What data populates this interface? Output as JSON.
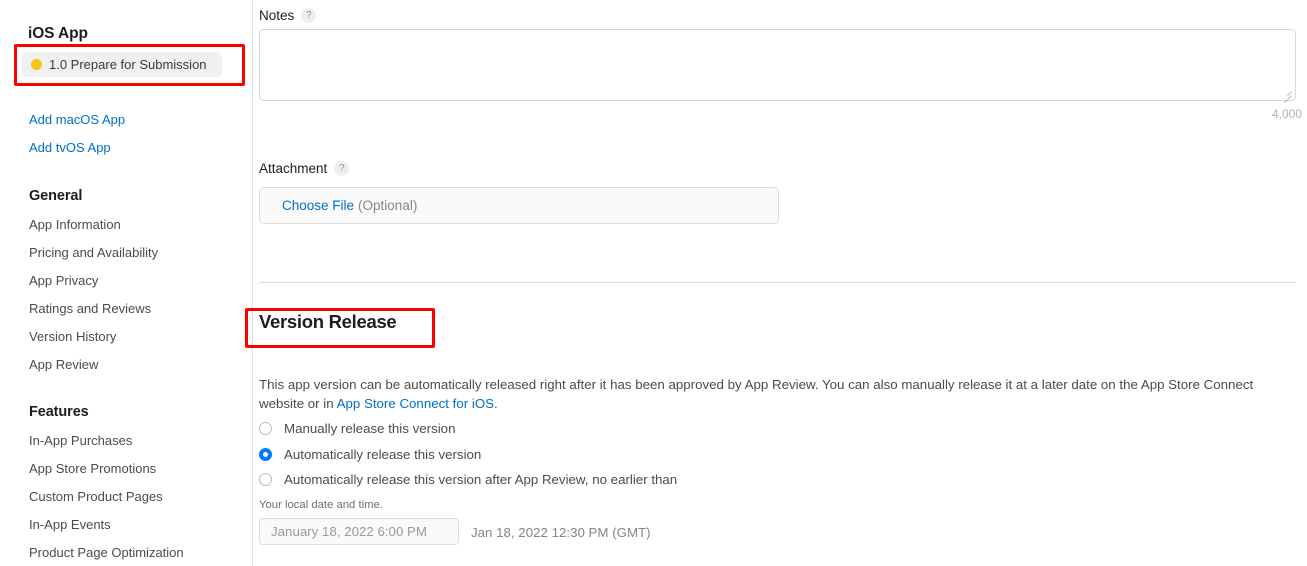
{
  "sidebar": {
    "app_title": "iOS App",
    "version_item": {
      "label": "1.0 Prepare for Submission",
      "status_icon": "yellow-status-dot",
      "status_color": "#f5c518",
      "highlighted": true
    },
    "links": [
      {
        "label": "Add macOS App"
      },
      {
        "label": "Add tvOS App"
      }
    ],
    "groups": [
      {
        "title": "General",
        "items": [
          {
            "label": "App Information"
          },
          {
            "label": "Pricing and Availability"
          },
          {
            "label": "App Privacy"
          },
          {
            "label": "Ratings and Reviews"
          },
          {
            "label": "Version History"
          },
          {
            "label": "App Review"
          }
        ]
      },
      {
        "title": "Features",
        "items": [
          {
            "label": "In-App Purchases"
          },
          {
            "label": "App Store Promotions"
          },
          {
            "label": "Custom Product Pages"
          },
          {
            "label": "In-App Events"
          },
          {
            "label": "Product Page Optimization"
          }
        ]
      }
    ]
  },
  "main": {
    "notes": {
      "label": "Notes",
      "help_icon": "question-mark-icon",
      "help_glyph": "?",
      "value": "",
      "char_counter": "4,000"
    },
    "attachment": {
      "label": "Attachment",
      "help_icon": "question-mark-icon",
      "help_glyph": "?",
      "choose_file_label": "Choose File",
      "optional_label": "(Optional)"
    },
    "version_release": {
      "title": "Version Release",
      "highlighted": true,
      "description_part1": "This app version can be automatically released right after it has been approved by App Review. You can also manually release it at a later date on the App Store Connect website or in ",
      "description_link": "App Store Connect for iOS.",
      "options": [
        {
          "label": "Manually release this version",
          "selected": false
        },
        {
          "label": "Automatically release this version",
          "selected": true
        },
        {
          "label": "Automatically release this version after App Review, no earlier than",
          "selected": false
        }
      ],
      "local_time_note": "Your local date and time.",
      "date_value": "January 18, 2022 6:00 PM",
      "gmt_note": "Jan 18, 2022 12:30 PM (GMT)"
    }
  },
  "colors": {
    "link": "#0070c9",
    "accent": "#007aff",
    "highlight": "#ff0000",
    "status_yellow": "#f5c518"
  }
}
